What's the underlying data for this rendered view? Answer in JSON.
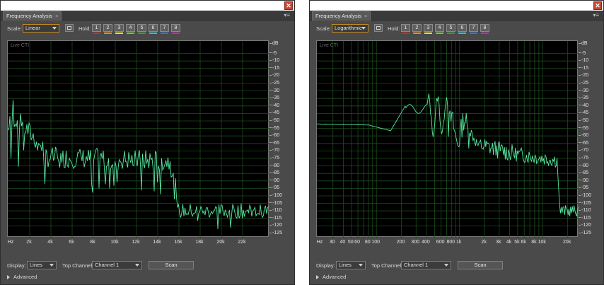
{
  "hold_colors": [
    "#e0231c",
    "#ff8a00",
    "#f2e40a",
    "#6ad51f",
    "#2ba72b",
    "#20c8d8",
    "#1e7bff",
    "#d41fc8"
  ],
  "trace_color": "#56e8a0",
  "panels": [
    {
      "tab_label": "Frequency Analysis",
      "scale_label": "Scale:",
      "scale_value": "Linear",
      "hold_label": "Hold:",
      "hold_buttons": [
        "1",
        "2",
        "3",
        "4",
        "5",
        "6",
        "7",
        "8"
      ],
      "live_label": "Live CTI",
      "y_ticks": [
        "dB",
        "-5",
        "-10",
        "-15",
        "-20",
        "-25",
        "-30",
        "-35",
        "-40",
        "-45",
        "-50",
        "-55",
        "-60",
        "-65",
        "-70",
        "-75",
        "-80",
        "-85",
        "-90",
        "-95",
        "-100",
        "-105",
        "-110",
        "-115",
        "-120",
        "-125"
      ],
      "x_ticks": [
        "Hz",
        "2k",
        "4k",
        "6k",
        "8k",
        "10k",
        "12k",
        "14k",
        "16k",
        "18k",
        "20k",
        "22k"
      ],
      "display_label": "Display:",
      "display_value": "Lines",
      "channel_label": "Top Channel:",
      "channel_value": "Channel 1",
      "scan_label": "Scan",
      "advanced_label": "Advanced"
    },
    {
      "tab_label": "Frequency Analysis",
      "scale_label": "Scale:",
      "scale_value": "Logarithmic",
      "hold_label": "Hold:",
      "hold_buttons": [
        "1",
        "2",
        "3",
        "4",
        "5",
        "6",
        "7",
        "8"
      ],
      "live_label": "Live CTI",
      "y_ticks": [
        "dB",
        "-5",
        "-10",
        "-15",
        "-20",
        "-25",
        "-30",
        "-35",
        "-40",
        "-45",
        "-50",
        "-55",
        "-60",
        "-65",
        "-70",
        "-75",
        "-80",
        "-85",
        "-90",
        "-95",
        "-100",
        "-105",
        "-110",
        "-115",
        "-120",
        "-125"
      ],
      "x_ticks": [
        "Hz",
        "30",
        "40",
        "50",
        "60",
        "80",
        "100",
        "200",
        "300",
        "400",
        "600",
        "800",
        "1k",
        "2k",
        "3k",
        "4k",
        "5k",
        "6k",
        "8k",
        "10k",
        "20k"
      ],
      "display_label": "Display:",
      "display_value": "Lines",
      "channel_label": "Top Channel:",
      "channel_value": "Channel 1",
      "scan_label": "Scan",
      "advanced_label": "Advanced"
    }
  ]
}
